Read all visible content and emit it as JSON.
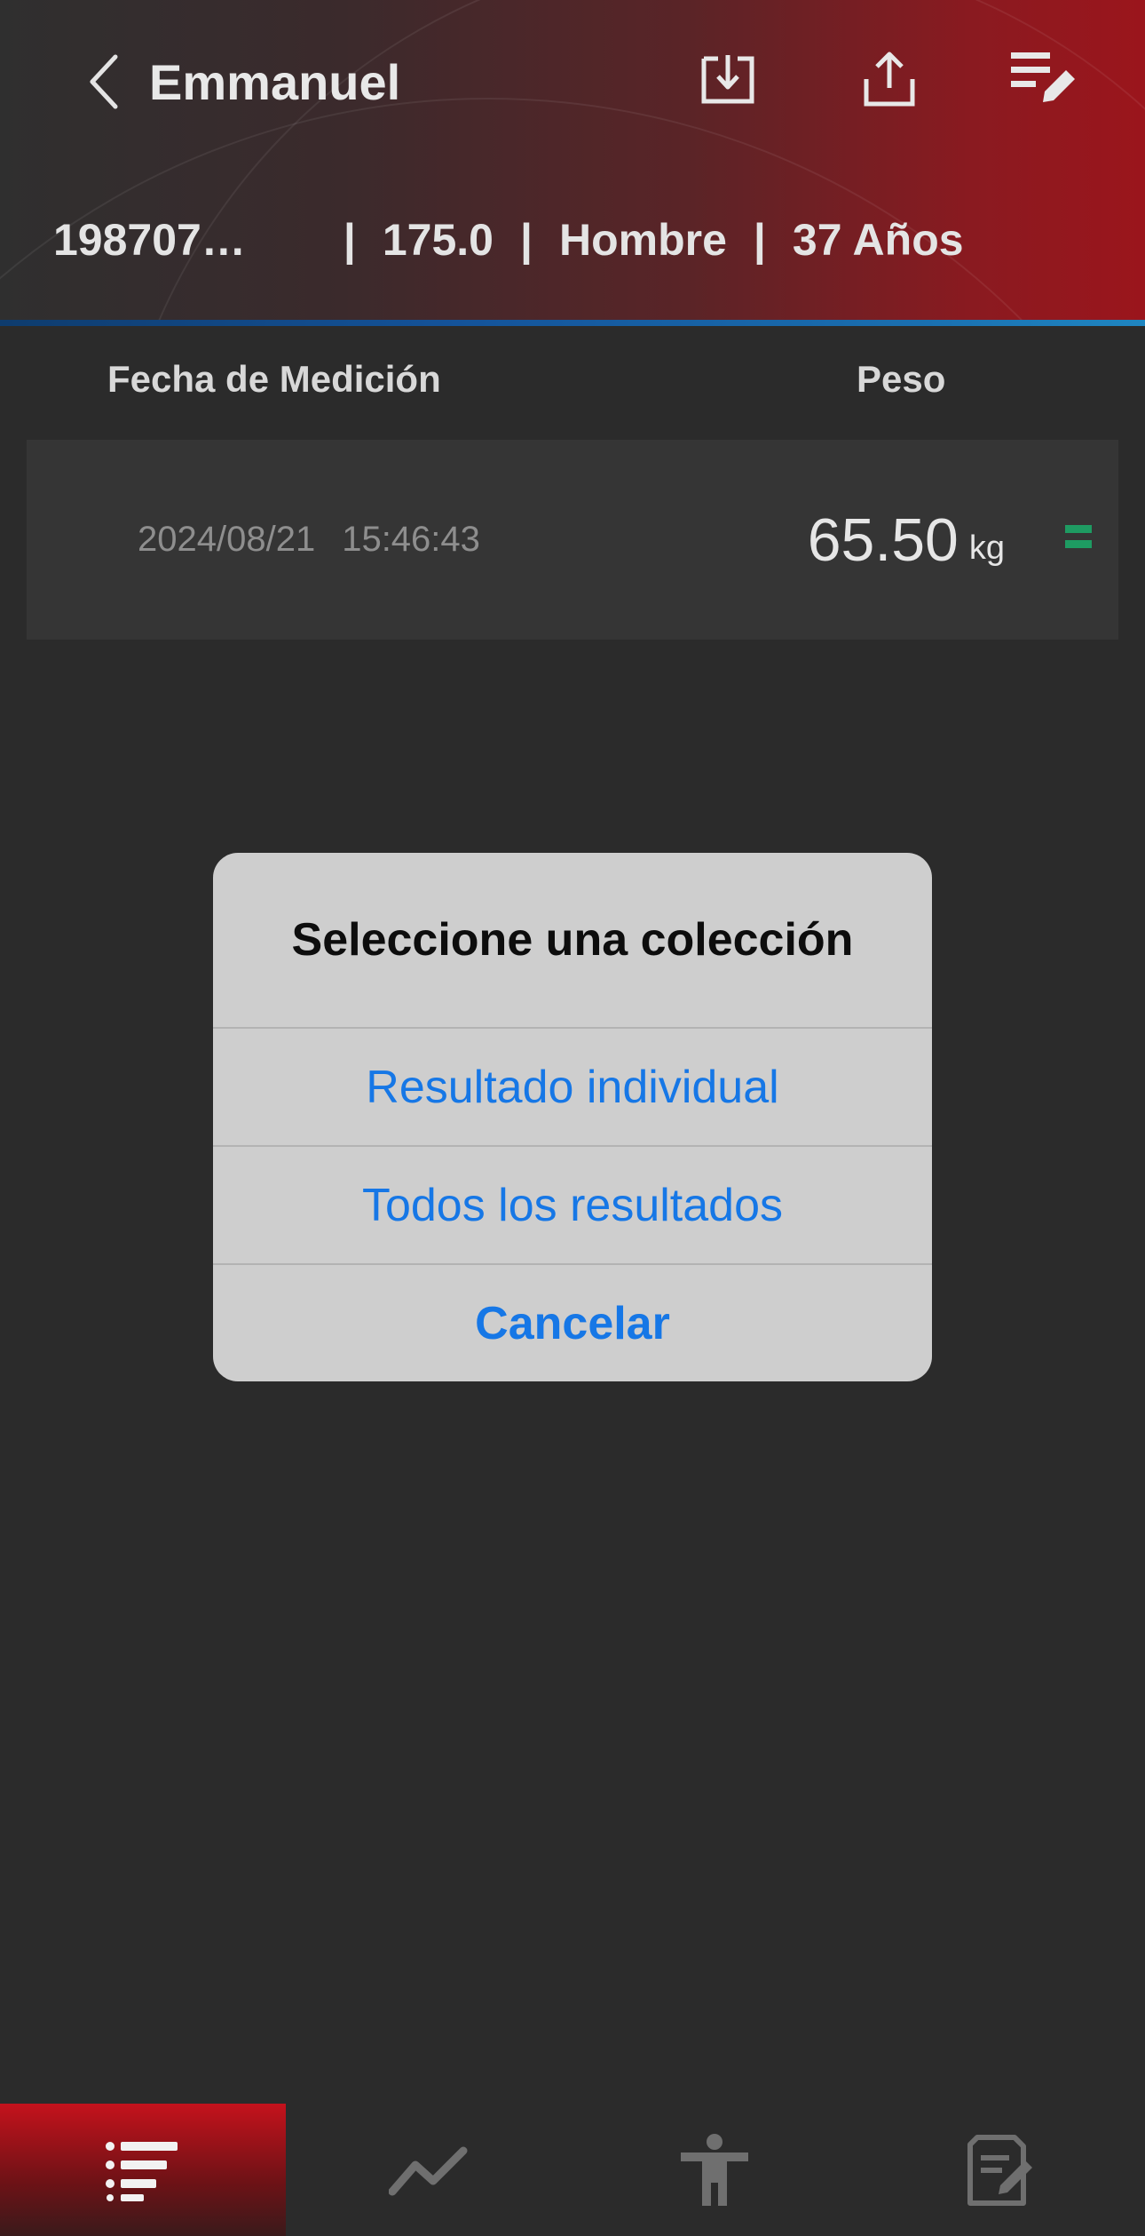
{
  "header": {
    "title": "Emmanuel",
    "id": "198707…",
    "height": "175.0",
    "gender": "Hombre",
    "age": "37 Años",
    "separator": "|",
    "icons": [
      "back-chevron-icon",
      "import-icon",
      "share-icon",
      "edit-list-icon"
    ]
  },
  "table": {
    "col_date": "Fecha de Medición",
    "col_weight": "Peso",
    "rows": [
      {
        "date": "2024/08/21",
        "time": "15:46:43",
        "weight": "65.50",
        "unit": "kg",
        "trend": "equal"
      }
    ]
  },
  "dialog": {
    "title": "Seleccione una colección",
    "option_single": "Resultado individual",
    "option_all": "Todos los resultados",
    "cancel": "Cancelar"
  },
  "tabbar": {
    "items": [
      "list-icon",
      "trend-chart-icon",
      "body-figure-icon",
      "notes-edit-icon"
    ],
    "active_index": 0
  },
  "colors": {
    "accent_red": "#c4121c",
    "dialog_blue": "#1677e6",
    "trend_green": "#1e9b62",
    "divider_blue": "#1a6fb0"
  }
}
